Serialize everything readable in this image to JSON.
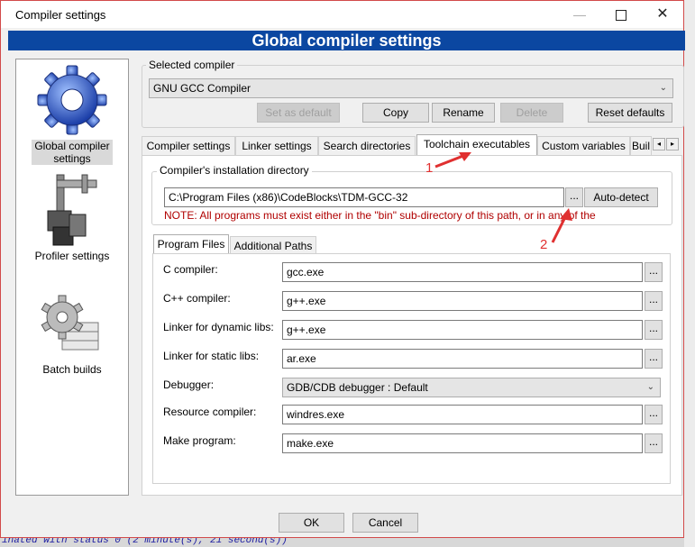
{
  "window": {
    "title": "Compiler settings",
    "minimize_glyph": "—",
    "close_glyph": "✕"
  },
  "header": {
    "title": "Global compiler settings"
  },
  "nav": {
    "items": [
      {
        "label": "Global compiler settings",
        "icon": "gear-icon",
        "selected": true
      },
      {
        "label": "Profiler settings",
        "icon": "caliper-icon"
      },
      {
        "label": "Batch builds",
        "icon": "batch-gear-icon"
      }
    ]
  },
  "compiler": {
    "group_label": "Selected compiler",
    "selected_value": "GNU GCC Compiler",
    "buttons": {
      "set_default": "Set as default",
      "copy": "Copy",
      "rename": "Rename",
      "delete": "Delete",
      "reset": "Reset defaults"
    }
  },
  "tabs": [
    {
      "label": "Compiler settings"
    },
    {
      "label": "Linker settings"
    },
    {
      "label": "Search directories"
    },
    {
      "label": "Toolchain executables",
      "active": true
    },
    {
      "label": "Custom variables"
    },
    {
      "label": "Buil"
    }
  ],
  "tab_scroll": {
    "left": "◂",
    "right": "▸"
  },
  "install_dir": {
    "label": "Compiler's installation directory",
    "value": "C:\\Program Files (x86)\\CodeBlocks\\TDM-GCC-32",
    "browse": "...",
    "autodetect": "Auto-detect",
    "note": "NOTE: All programs must exist either in the \"bin\" sub-directory of this path, or in any of the"
  },
  "annotations": {
    "one": "1",
    "two": "2"
  },
  "subtabs": [
    {
      "label": "Program Files",
      "active": true
    },
    {
      "label": "Additional Paths"
    }
  ],
  "programs": [
    {
      "label": "C compiler:",
      "value": "gcc.exe",
      "type": "input"
    },
    {
      "label": "C++ compiler:",
      "value": "g++.exe",
      "type": "input"
    },
    {
      "label": "Linker for dynamic libs:",
      "value": "g++.exe",
      "type": "input"
    },
    {
      "label": "Linker for static libs:",
      "value": "ar.exe",
      "type": "input"
    },
    {
      "label": "Debugger:",
      "value": "GDB/CDB debugger : Default",
      "type": "select"
    },
    {
      "label": "Resource compiler:",
      "value": "windres.exe",
      "type": "input"
    },
    {
      "label": "Make program:",
      "value": "make.exe",
      "type": "input"
    }
  ],
  "footer": {
    "ok": "OK",
    "cancel": "Cancel"
  },
  "background": {
    "status_text": "inated with status 0 (2 minute(s), 21 second(s))"
  },
  "colors": {
    "header_bg": "#0b47a1",
    "note_text": "#b00000",
    "annotation": "#e03030"
  }
}
